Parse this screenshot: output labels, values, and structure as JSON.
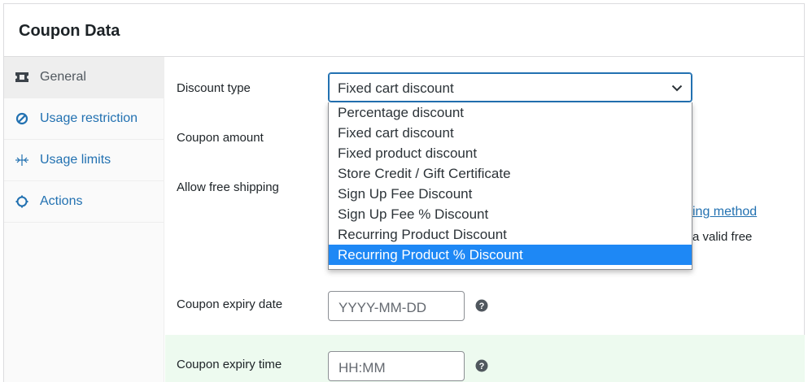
{
  "panel": {
    "title": "Coupon Data"
  },
  "tabs": [
    {
      "label": "General",
      "icon": "ticket-icon",
      "active": true
    },
    {
      "label": "Usage restriction",
      "icon": "block-icon",
      "active": false
    },
    {
      "label": "Usage limits",
      "icon": "limits-icon",
      "active": false
    },
    {
      "label": "Actions",
      "icon": "actions-icon",
      "active": false
    }
  ],
  "fields": {
    "discount_type": {
      "label": "Discount type",
      "selected": "Fixed cart discount",
      "options": [
        "Percentage discount",
        "Fixed cart discount",
        "Fixed product discount",
        "Store Credit / Gift Certificate",
        "Sign Up Fee Discount",
        "Sign Up Fee % Discount",
        "Recurring Product Discount",
        "Recurring Product % Discount"
      ],
      "highlighted": "Recurring Product % Discount"
    },
    "coupon_amount": {
      "label": "Coupon amount"
    },
    "free_shipping": {
      "label": "Allow free shipping",
      "partial_link": "ing method",
      "partial_text": "a valid free"
    },
    "expiry_date": {
      "label": "Coupon expiry date",
      "placeholder": "YYYY-MM-DD"
    },
    "expiry_time": {
      "label": "Coupon expiry time",
      "placeholder": "HH:MM"
    }
  },
  "colors": {
    "link": "#2271b1",
    "highlight": "#1e88f5",
    "green_band": "#edfaef"
  }
}
